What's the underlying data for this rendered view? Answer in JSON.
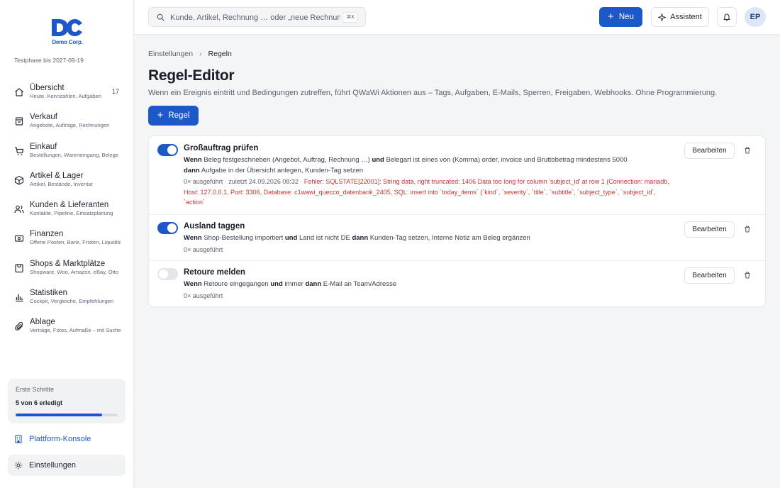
{
  "sidebar": {
    "logo_mark": "DC",
    "logo_text": "Demo Corp.",
    "trial_text": "Testphase bis 2027-09-19",
    "items": [
      {
        "label": "Übersicht",
        "sub": "Heute, Kennzahlen, Aufgaben",
        "badge": "17",
        "icon": "home-icon"
      },
      {
        "label": "Verkauf",
        "sub": "Angebote, Aufträge, Rechnungen",
        "icon": "receipt-icon"
      },
      {
        "label": "Einkauf",
        "sub": "Bestellungen, Wareneingang, Belege",
        "icon": "cart-icon"
      },
      {
        "label": "Artikel & Lager",
        "sub": "Artikel, Bestände, Inventur",
        "icon": "box-icon"
      },
      {
        "label": "Kunden & Lieferanten",
        "sub": "Kontakte, Pipeline, Einsatzplanung",
        "icon": "users-icon"
      },
      {
        "label": "Finanzen",
        "sub": "Offene Posten, Bank, Fristen, Liquidität",
        "icon": "money-icon"
      },
      {
        "label": "Shops & Marktplätze",
        "sub": "Shopware, Woo, Amazon, eBay, Otto",
        "icon": "shop-icon"
      },
      {
        "label": "Statistiken",
        "sub": "Cockpit, Vergleiche, Empfehlungen",
        "icon": "chart-icon"
      },
      {
        "label": "Ablage",
        "sub": "Verträge, Fotos, Aufmaße – mit Suche",
        "icon": "paperclip-icon"
      }
    ],
    "progress": {
      "title": "Erste Schritte",
      "value": "5 von 6 erledigt",
      "fraction": 0.845
    },
    "platform_label": "Plattform-Konsole",
    "settings_label": "Einstellungen"
  },
  "topbar": {
    "search_placeholder": "Kunde, Artikel, Rechnung … oder „neue Rechnung“",
    "search_shortcut": "⌘K",
    "new_label": "Neu",
    "assistant_label": "Assistent",
    "avatar_initials": "EP"
  },
  "breadcrumb": {
    "parent": "Einstellungen",
    "current": "Regeln"
  },
  "page": {
    "title": "Regel-Editor",
    "subtitle": "Wenn ein Ereignis eintritt und Bedingungen zutreffen, führt QWaWi Aktionen aus – Tags, Aufgaben, E-Mails, Sperren, Freigaben, Webhooks. Ohne Programmierung.",
    "add_rule_label": "Regel"
  },
  "rules": [
    {
      "name": "Großauftrag prüfen",
      "enabled": true,
      "kw_when": "Wenn",
      "trigger": "Beleg festgeschrieben (Angebot, Auftrag, Rechnung …)",
      "kw_and": "und",
      "condition": "Belegart ist eines von (Komma) order, invoice und Bruttobetrag mindestens 5000",
      "kw_then": "dann",
      "action": "Aufgabe in der Übersicht anlegen, Kunden-Tag setzen",
      "runs": "0× ausgeführt · zuletzt 24.09.2026 08:32 · ",
      "error": "Fehler: SQLSTATE[22001]: String data, right truncated: 1406 Data too long for column 'subject_id' at row 1 (Connection: mariadb, Host: 127.0.0.1, Port: 3306, Database: c1wawi_quecco_datenbank_2405, SQL: insert into `today_items` (`kind`, `severity`, `title`, `subtitle`, `subject_type`, `subject_id`, `action`",
      "edit_label": "Bearbeiten"
    },
    {
      "name": "Ausland taggen",
      "enabled": true,
      "kw_when": "Wenn",
      "trigger": "Shop-Bestellung importiert",
      "kw_and": "und",
      "condition": "Land ist nicht DE",
      "kw_then": "dann",
      "action": "Kunden-Tag setzen, Interne Notiz am Beleg ergänzen",
      "runs": "0× ausgeführt",
      "edit_label": "Bearbeiten"
    },
    {
      "name": "Retoure melden",
      "enabled": false,
      "kw_when": "Wenn",
      "trigger": "Retoure eingegangen",
      "kw_and": "und",
      "condition": "immer",
      "kw_then": "dann",
      "action": "E-Mail an Team/Adresse",
      "runs": "0× ausgeführt",
      "edit_label": "Bearbeiten"
    }
  ],
  "colors": {
    "accent": "#1d58c9",
    "error": "#c83434"
  }
}
